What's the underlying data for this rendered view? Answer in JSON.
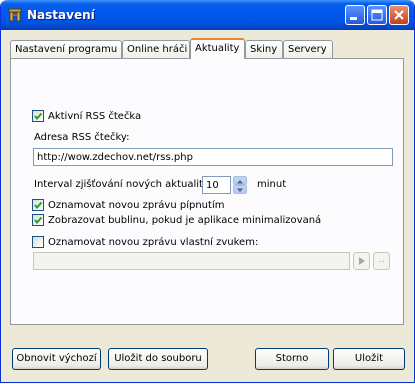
{
  "window": {
    "title": "Nastavení"
  },
  "tabs": [
    {
      "label": "Nastavení programu"
    },
    {
      "label": "Online hráči"
    },
    {
      "label": "Aktuality"
    },
    {
      "label": "Skiny"
    },
    {
      "label": "Servery"
    }
  ],
  "rss": {
    "enabled_label": "Aktivní RSS čtečka",
    "enabled": true,
    "address_label": "Adresa RSS čtečky:",
    "address_value": "http://wow.zdechov.net/rss.php",
    "interval_label": "Interval zjišťování nových aktualit:",
    "interval_value": "10",
    "interval_unit": "minut",
    "notify_beep_label": "Oznamovat novou zprávu pípnutím",
    "notify_beep": true,
    "balloon_label": "Zobrazovat bublinu, pokud je aplikace minimalizovaná",
    "balloon": true,
    "custom_sound_label": "Oznamovat novou zprávu vlastní zvukem:",
    "custom_sound": false,
    "custom_sound_value": "",
    "browse_label": ".."
  },
  "buttons": {
    "restore": "Obnovit výchozí",
    "save_to_file": "Uložit do souboru",
    "cancel": "Storno",
    "save": "Uložit"
  }
}
